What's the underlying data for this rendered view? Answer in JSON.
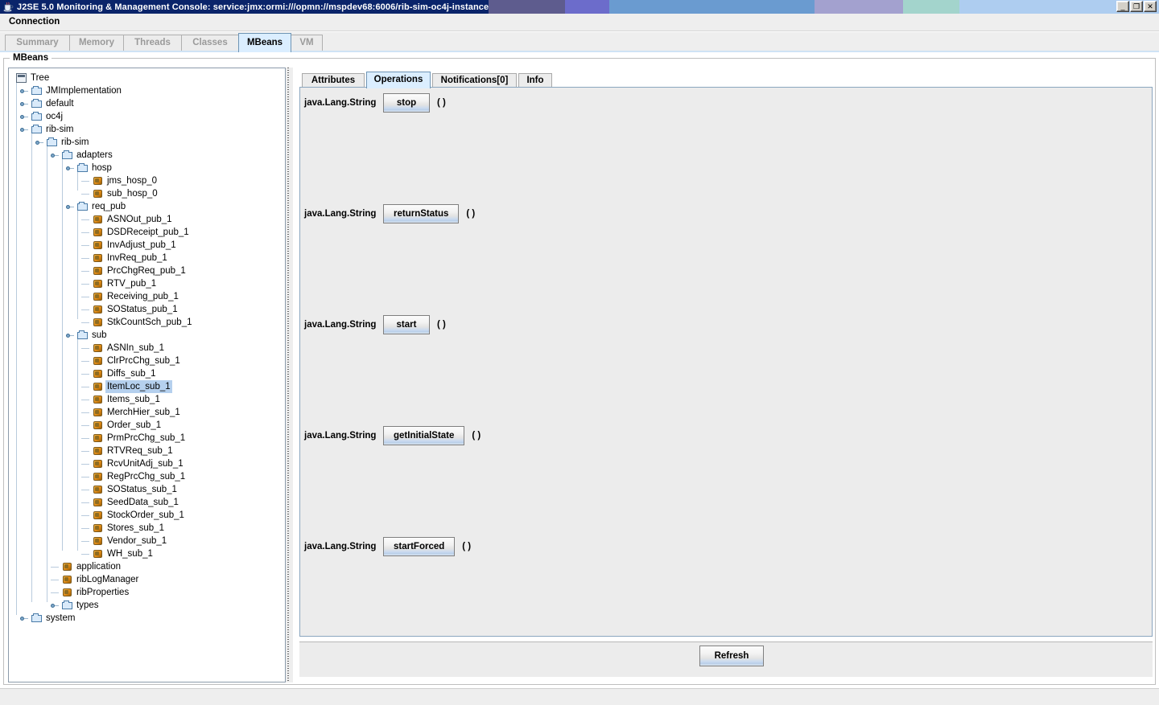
{
  "window": {
    "title": "J2SE 5.0 Monitoring & Management Console: service:jmx:ormi:///opmn://mspdev68:6006/rib-sim-oc4j-instance",
    "app_icon": "java-cup-icon",
    "minimize_label": "_",
    "maximize_label": "❐",
    "close_label": "✕",
    "titlebar_color": "#0a246a",
    "segment_colors": [
      "#5e5c8e",
      "#6c6ccb",
      "#6a9bd0",
      "#a3a1cf",
      "#a3d4cc",
      "#aecdf0"
    ]
  },
  "menubar": {
    "items": [
      "Connection"
    ]
  },
  "tabs": {
    "items": [
      {
        "label": "Summary",
        "selected": false,
        "enabled": false
      },
      {
        "label": "Memory",
        "selected": false,
        "enabled": false
      },
      {
        "label": "Threads",
        "selected": false,
        "enabled": false
      },
      {
        "label": "Classes",
        "selected": false,
        "enabled": false
      },
      {
        "label": "MBeans",
        "selected": true,
        "enabled": true
      },
      {
        "label": "VM",
        "selected": false,
        "enabled": false
      }
    ]
  },
  "panel": {
    "legend": "MBeans"
  },
  "tree": {
    "selected": "ItemLoc_sub_1",
    "nodes": [
      {
        "label": "Tree",
        "depth": 0,
        "icon": "tree-icon",
        "handle": "none"
      },
      {
        "label": "JMImplementation",
        "depth": 1,
        "icon": "folder-icon",
        "handle": "collapsed"
      },
      {
        "label": "default",
        "depth": 1,
        "icon": "folder-icon",
        "handle": "collapsed"
      },
      {
        "label": "oc4j",
        "depth": 1,
        "icon": "folder-icon",
        "handle": "collapsed"
      },
      {
        "label": "rib-sim",
        "depth": 1,
        "icon": "folder-icon",
        "handle": "expanded"
      },
      {
        "label": "rib-sim",
        "depth": 2,
        "icon": "folder-icon",
        "handle": "expanded"
      },
      {
        "label": "adapters",
        "depth": 3,
        "icon": "folder-icon",
        "handle": "expanded"
      },
      {
        "label": "hosp",
        "depth": 4,
        "icon": "folder-icon",
        "handle": "expanded"
      },
      {
        "label": "jms_hosp_0",
        "depth": 5,
        "icon": "mbean-icon",
        "handle": "leaf"
      },
      {
        "label": "sub_hosp_0",
        "depth": 5,
        "icon": "mbean-icon",
        "handle": "leaf"
      },
      {
        "label": "req_pub",
        "depth": 4,
        "icon": "folder-icon",
        "handle": "expanded"
      },
      {
        "label": "ASNOut_pub_1",
        "depth": 5,
        "icon": "mbean-icon",
        "handle": "leaf"
      },
      {
        "label": "DSDReceipt_pub_1",
        "depth": 5,
        "icon": "mbean-icon",
        "handle": "leaf"
      },
      {
        "label": "InvAdjust_pub_1",
        "depth": 5,
        "icon": "mbean-icon",
        "handle": "leaf"
      },
      {
        "label": "InvReq_pub_1",
        "depth": 5,
        "icon": "mbean-icon",
        "handle": "leaf"
      },
      {
        "label": "PrcChgReq_pub_1",
        "depth": 5,
        "icon": "mbean-icon",
        "handle": "leaf"
      },
      {
        "label": "RTV_pub_1",
        "depth": 5,
        "icon": "mbean-icon",
        "handle": "leaf"
      },
      {
        "label": "Receiving_pub_1",
        "depth": 5,
        "icon": "mbean-icon",
        "handle": "leaf"
      },
      {
        "label": "SOStatus_pub_1",
        "depth": 5,
        "icon": "mbean-icon",
        "handle": "leaf"
      },
      {
        "label": "StkCountSch_pub_1",
        "depth": 5,
        "icon": "mbean-icon",
        "handle": "leaf"
      },
      {
        "label": "sub",
        "depth": 4,
        "icon": "folder-icon",
        "handle": "expanded"
      },
      {
        "label": "ASNIn_sub_1",
        "depth": 5,
        "icon": "mbean-icon",
        "handle": "leaf"
      },
      {
        "label": "ClrPrcChg_sub_1",
        "depth": 5,
        "icon": "mbean-icon",
        "handle": "leaf"
      },
      {
        "label": "Diffs_sub_1",
        "depth": 5,
        "icon": "mbean-icon",
        "handle": "leaf"
      },
      {
        "label": "ItemLoc_sub_1",
        "depth": 5,
        "icon": "mbean-icon",
        "handle": "leaf"
      },
      {
        "label": "Items_sub_1",
        "depth": 5,
        "icon": "mbean-icon",
        "handle": "leaf"
      },
      {
        "label": "MerchHier_sub_1",
        "depth": 5,
        "icon": "mbean-icon",
        "handle": "leaf"
      },
      {
        "label": "Order_sub_1",
        "depth": 5,
        "icon": "mbean-icon",
        "handle": "leaf"
      },
      {
        "label": "PrmPrcChg_sub_1",
        "depth": 5,
        "icon": "mbean-icon",
        "handle": "leaf"
      },
      {
        "label": "RTVReq_sub_1",
        "depth": 5,
        "icon": "mbean-icon",
        "handle": "leaf"
      },
      {
        "label": "RcvUnitAdj_sub_1",
        "depth": 5,
        "icon": "mbean-icon",
        "handle": "leaf"
      },
      {
        "label": "RegPrcChg_sub_1",
        "depth": 5,
        "icon": "mbean-icon",
        "handle": "leaf"
      },
      {
        "label": "SOStatus_sub_1",
        "depth": 5,
        "icon": "mbean-icon",
        "handle": "leaf"
      },
      {
        "label": "SeedData_sub_1",
        "depth": 5,
        "icon": "mbean-icon",
        "handle": "leaf"
      },
      {
        "label": "StockOrder_sub_1",
        "depth": 5,
        "icon": "mbean-icon",
        "handle": "leaf"
      },
      {
        "label": "Stores_sub_1",
        "depth": 5,
        "icon": "mbean-icon",
        "handle": "leaf"
      },
      {
        "label": "Vendor_sub_1",
        "depth": 5,
        "icon": "mbean-icon",
        "handle": "leaf"
      },
      {
        "label": "WH_sub_1",
        "depth": 5,
        "icon": "mbean-icon",
        "handle": "leaf"
      },
      {
        "label": "application",
        "depth": 3,
        "icon": "mbean-icon",
        "handle": "leaf"
      },
      {
        "label": "ribLogManager",
        "depth": 3,
        "icon": "mbean-icon",
        "handle": "leaf"
      },
      {
        "label": "ribProperties",
        "depth": 3,
        "icon": "mbean-icon",
        "handle": "leaf"
      },
      {
        "label": "types",
        "depth": 3,
        "icon": "folder-icon",
        "handle": "collapsed"
      },
      {
        "label": "system",
        "depth": 1,
        "icon": "folder-icon",
        "handle": "collapsed"
      }
    ]
  },
  "detail": {
    "tabs": [
      {
        "label": "Attributes",
        "selected": false
      },
      {
        "label": "Operations",
        "selected": true
      },
      {
        "label": "Notifications[0]",
        "selected": false
      },
      {
        "label": "Info",
        "selected": false
      }
    ],
    "operations": [
      {
        "return_type": "java.Lang.String",
        "name": "stop",
        "params": "( )"
      },
      {
        "return_type": "java.Lang.String",
        "name": "returnStatus",
        "params": "( )"
      },
      {
        "return_type": "java.Lang.String",
        "name": "start",
        "params": "( )"
      },
      {
        "return_type": "java.Lang.String",
        "name": "getInitialState",
        "params": "( )"
      },
      {
        "return_type": "java.Lang.String",
        "name": "startForced",
        "params": "( )"
      }
    ],
    "refresh_label": "Refresh"
  }
}
